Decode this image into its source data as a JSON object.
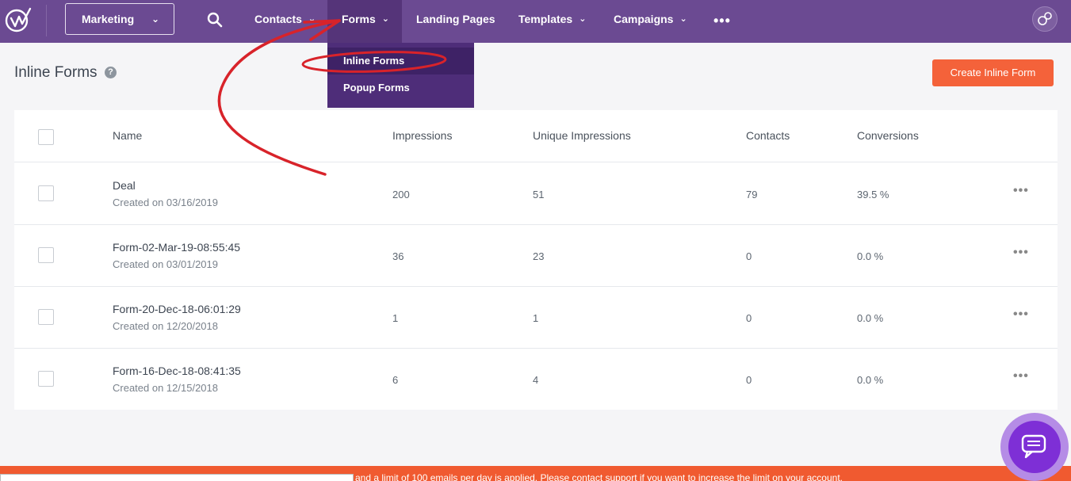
{
  "nav": {
    "module": "Marketing",
    "items": [
      {
        "label": "Contacts"
      },
      {
        "label": "Forms"
      },
      {
        "label": "Landing Pages"
      },
      {
        "label": "Templates"
      },
      {
        "label": "Campaigns"
      }
    ],
    "more": "•••"
  },
  "dropdown": {
    "items": [
      {
        "label": "Inline Forms"
      },
      {
        "label": "Popup Forms"
      }
    ]
  },
  "page": {
    "title": "Inline Forms",
    "help": "?",
    "create_button": "Create Inline Form"
  },
  "table": {
    "columns": [
      "Name",
      "Impressions",
      "Unique Impressions",
      "Contacts",
      "Conversions"
    ],
    "rows": [
      {
        "name": "Deal",
        "created": "Created on 03/16/2019",
        "impressions": "200",
        "unique": "51",
        "contacts": "79",
        "conversions": "39.5 %",
        "menu": "•••"
      },
      {
        "name": "Form-02-Mar-19-08:55:45",
        "created": "Created on 03/01/2019",
        "impressions": "36",
        "unique": "23",
        "contacts": "0",
        "conversions": "0.0 %",
        "menu": "•••"
      },
      {
        "name": "Form-20-Dec-18-06:01:29",
        "created": "Created on 12/20/2018",
        "impressions": "1",
        "unique": "1",
        "contacts": "0",
        "conversions": "0.0 %",
        "menu": "•••"
      },
      {
        "name": "Form-16-Dec-18-08:41:35",
        "created": "Created on 12/15/2018",
        "impressions": "6",
        "unique": "4",
        "contacts": "0",
        "conversions": "0.0 %",
        "menu": "•••"
      }
    ]
  },
  "banner": {
    "text": "and a limit of 100 emails per day is applied. Please contact support if you want to increase the limit on your account."
  },
  "colors": {
    "nav_bg": "#6b4a92",
    "nav_active": "#553479",
    "dropdown_bg": "#4e2d79",
    "accent": "#f4623a",
    "annotation": "#d8232a",
    "chat": "#7e2fd6"
  },
  "icons": [
    "logo-icon",
    "search-icon",
    "chevron-down-icon",
    "more-icon",
    "avatar-icon",
    "help-icon",
    "row-menu-icon",
    "chat-icon"
  ]
}
